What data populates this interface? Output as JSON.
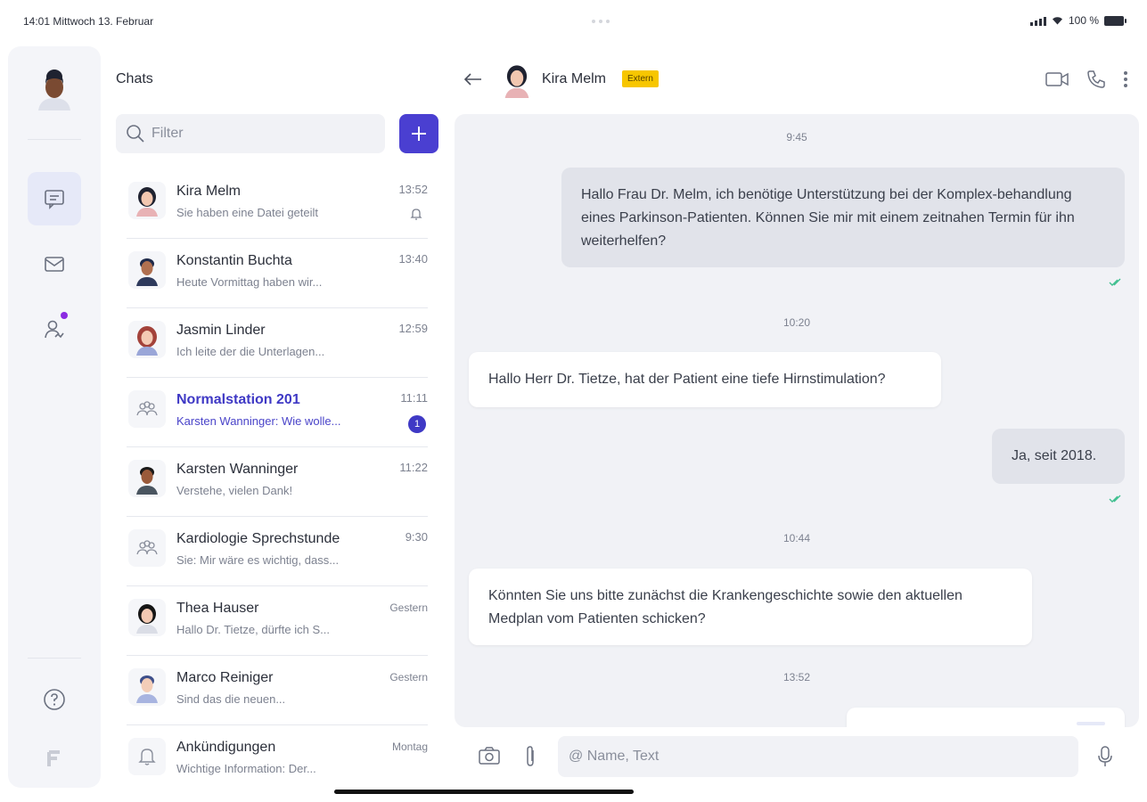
{
  "status_bar": {
    "time_date": "14:01  Mittwoch 13. Februar",
    "battery": "100 %"
  },
  "rail": {
    "items": [
      {
        "icon": "chat-icon",
        "active": true
      },
      {
        "icon": "mail-icon",
        "active": false
      },
      {
        "icon": "contacts-icon",
        "active": false,
        "badge": true
      },
      {
        "icon": "help-icon",
        "active": false
      },
      {
        "icon": "logo-icon",
        "active": false
      }
    ]
  },
  "chats": {
    "title": "Chats",
    "filter_placeholder": "Filter",
    "items": [
      {
        "name": "Kira Melm",
        "preview": "Sie haben eine Datei geteilt",
        "time": "13:52",
        "muted": true,
        "avatar": "woman-dark"
      },
      {
        "name": "Konstantin Buchta",
        "preview": "Heute Vormittag haben wir...",
        "time": "13:40",
        "avatar": "man-dark"
      },
      {
        "name": "Jasmin Linder",
        "preview": "Ich leite der die Unterlagen...",
        "time": "12:59",
        "avatar": "woman-red"
      },
      {
        "name": "Normalstation 201",
        "preview": "Karsten Wanninger: Wie wolle...",
        "time": "11:11",
        "unread": "1",
        "avatar": "group"
      },
      {
        "name": "Karsten Wanninger",
        "preview": "Verstehe, vielen Dank!",
        "time": "11:22",
        "avatar": "man-brown"
      },
      {
        "name": "Kardiologie Sprechstunde",
        "preview": "Sie: Mir wäre es wichtig, dass...",
        "time": "9:30",
        "avatar": "group"
      },
      {
        "name": "Thea Hauser",
        "preview": "Hallo Dr. Tietze, dürfte ich S...",
        "time": "Gestern",
        "avatar": "woman-black"
      },
      {
        "name": "Marco Reiniger",
        "preview": "Sind das die neuen...",
        "time": "Gestern",
        "avatar": "man-light"
      },
      {
        "name": "Ankündigungen",
        "preview": "Wichtige Information: Der...",
        "time": "Montag",
        "avatar": "bell"
      }
    ]
  },
  "conversation": {
    "contact_name": "Kira Melm",
    "contact_badge": "Extern",
    "messages": [
      {
        "type": "timestamp",
        "text": "9:45"
      },
      {
        "type": "out",
        "text": "Hallo Frau Dr. Melm, ich benötige Unterstützung bei der Komplex-behandlung eines Parkinson-Patienten. Können Sie mir mit einem zeitnahen Termin für ihn weiterhelfen?"
      },
      {
        "type": "timestamp",
        "text": "10:20"
      },
      {
        "type": "in",
        "text": "Hallo Herr Dr. Tietze, hat der Patient eine tiefe Hirnstimulation?"
      },
      {
        "type": "out",
        "text": "Ja, seit 2018."
      },
      {
        "type": "timestamp",
        "text": "10:44"
      },
      {
        "type": "in",
        "text": "Könnten Sie uns bitte zunächst die Krankengeschichte sowie den aktuellen Medplan vom Patienten schicken?"
      },
      {
        "type": "timestamp",
        "text": "13:52"
      }
    ]
  },
  "composer": {
    "placeholder": "@ Name, Text"
  },
  "colors": {
    "accent": "#4a3fd1",
    "badge_extern": "#f7c600",
    "read_tick": "#3fbf8f"
  }
}
